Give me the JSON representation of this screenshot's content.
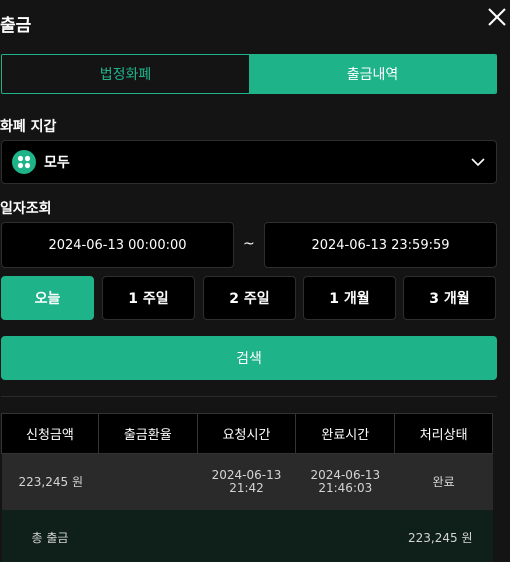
{
  "header": {
    "title": "출금"
  },
  "tabs": [
    {
      "label": "법정화폐",
      "active": false
    },
    {
      "label": "출금내역",
      "active": true
    }
  ],
  "wallet": {
    "label": "화폐 지갑",
    "selected": "모두",
    "icon": "grid-coin-icon"
  },
  "date_filter": {
    "label": "일자조회",
    "start": "2024-06-13 00:00:00",
    "end": "2024-06-13 23:59:59",
    "separator": "~"
  },
  "ranges": [
    {
      "label": "오늘",
      "selected": true
    },
    {
      "label": "1 주일",
      "selected": false
    },
    {
      "label": "2 주일",
      "selected": false
    },
    {
      "label": "1 개월",
      "selected": false
    },
    {
      "label": "3 개월",
      "selected": false
    }
  ],
  "search": {
    "label": "검색"
  },
  "table": {
    "columns": [
      "신청금액",
      "출금환율",
      "요청시간",
      "완료시간",
      "처리상태"
    ],
    "rows": [
      {
        "amount": "223,245 원",
        "rate": "",
        "requested_date": "2024-06-13",
        "requested_time": "21:42",
        "completed_date": "2024-06-13",
        "completed_time": "21:46:03",
        "status": "완료"
      }
    ],
    "total": {
      "label": "총 출금",
      "amount": "223,245",
      "unit": "원"
    }
  },
  "colors": {
    "accent": "#1fb38a",
    "background": "#141414",
    "status_done": "#4cd964"
  }
}
